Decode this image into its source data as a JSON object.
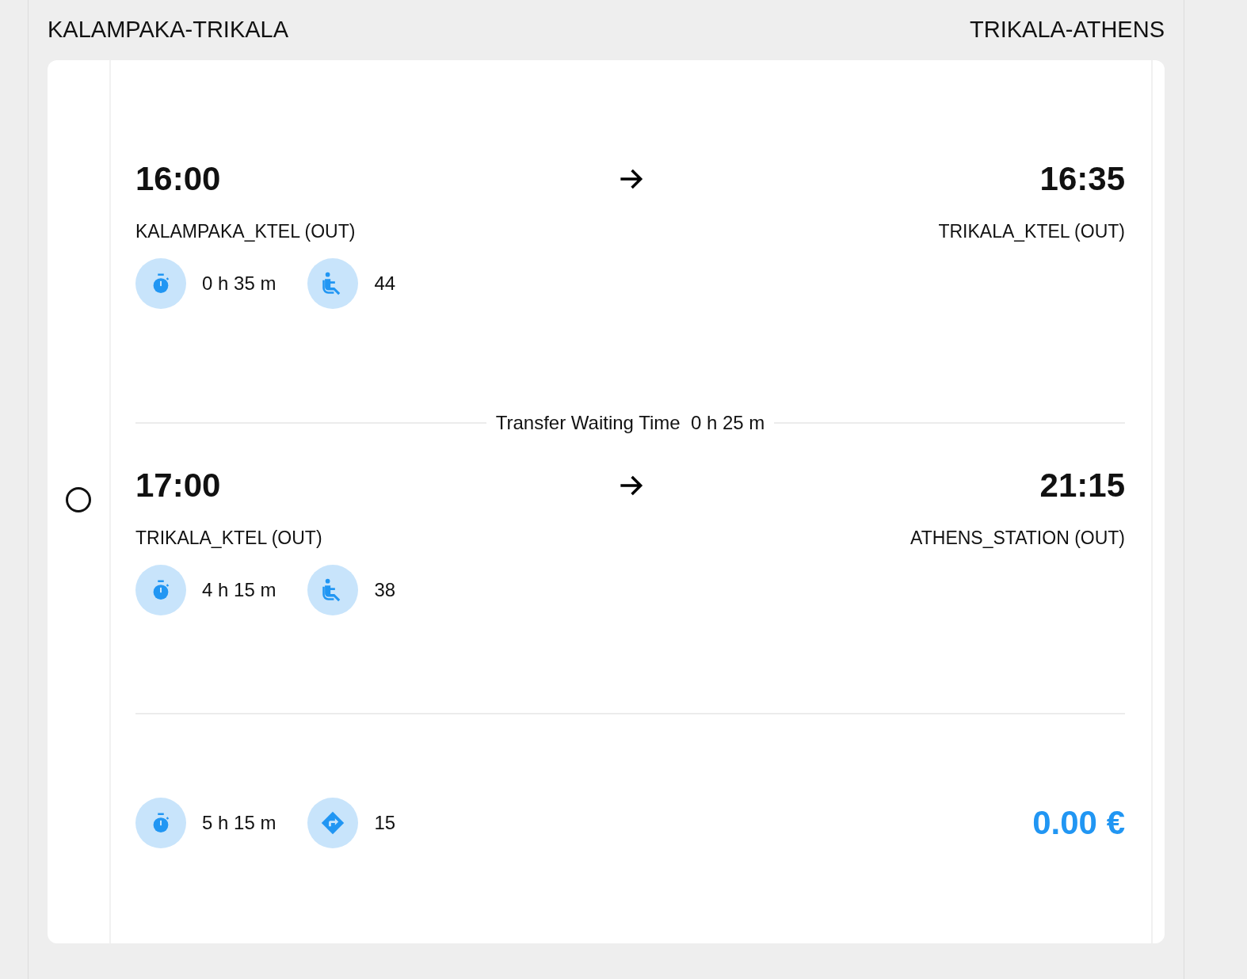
{
  "route_headers": [
    {
      "label": "KALAMPAKA-TRIKALA"
    },
    {
      "label": "TRIKALA-ATHENS"
    }
  ],
  "option": {
    "selected": false,
    "legs": [
      {
        "departure_time": "16:00",
        "arrival_time": "16:35",
        "from": "KALAMPAKA_KTEL (OUT)",
        "to": "TRIKALA_KTEL (OUT)",
        "info": [
          {
            "kind": "duration",
            "value": "0 h 35 m"
          },
          {
            "kind": "seats",
            "value": "44"
          }
        ],
        "transfer_after": {
          "label": "Transfer Waiting Time",
          "duration": "0 h 25 m"
        }
      },
      {
        "departure_time": "17:00",
        "arrival_time": "21:15",
        "from": "TRIKALA_KTEL (OUT)",
        "to": "ATHENS_STATION (OUT)",
        "info": [
          {
            "kind": "duration",
            "value": "4 h 15 m"
          },
          {
            "kind": "seats",
            "value": "38"
          }
        ]
      }
    ],
    "summary": {
      "info": [
        {
          "kind": "duration",
          "value": "5 h 15 m"
        },
        {
          "kind": "distance",
          "value": "15"
        }
      ],
      "price": "0.00 €"
    }
  }
}
